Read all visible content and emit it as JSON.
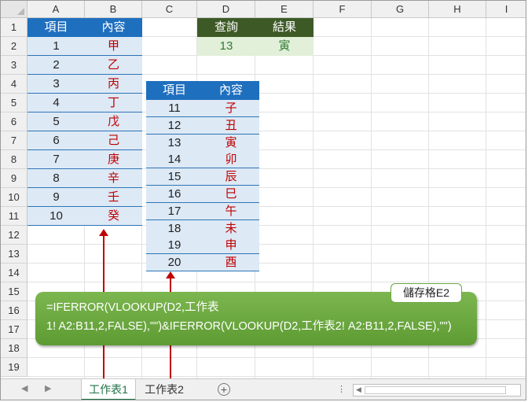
{
  "columns": [
    "A",
    "B",
    "C",
    "D",
    "E",
    "F",
    "G",
    "H",
    "I"
  ],
  "rows": [
    "1",
    "2",
    "3",
    "4",
    "5",
    "6",
    "7",
    "8",
    "9",
    "10",
    "11",
    "12",
    "13",
    "14",
    "15",
    "16",
    "17",
    "18",
    "19"
  ],
  "table1": {
    "headers": [
      "項目",
      "內容"
    ],
    "rows": [
      [
        "1",
        "甲"
      ],
      [
        "2",
        "乙"
      ],
      [
        "3",
        "丙"
      ],
      [
        "4",
        "丁"
      ],
      [
        "5",
        "戊"
      ],
      [
        "6",
        "己"
      ],
      [
        "7",
        "庚"
      ],
      [
        "8",
        "辛"
      ],
      [
        "9",
        "壬"
      ],
      [
        "10",
        "癸"
      ]
    ]
  },
  "table2": {
    "headers": [
      "項目",
      "內容"
    ],
    "rows": [
      [
        "11",
        "子"
      ],
      [
        "12",
        "丑"
      ],
      [
        "13",
        "寅"
      ],
      [
        "14",
        "卯"
      ],
      [
        "15",
        "辰"
      ],
      [
        "16",
        "巳"
      ],
      [
        "17",
        "午"
      ],
      [
        "18",
        "未"
      ],
      [
        "19",
        "申"
      ],
      [
        "20",
        "酉"
      ]
    ]
  },
  "lookup": {
    "headers": [
      "查詢",
      "結果"
    ],
    "query": "13",
    "result": "寅"
  },
  "callout": {
    "tag": "儲存格E2",
    "line1": "=IFERROR(VLOOKUP(D2,工作表",
    "line2": "1! A2:B11,2,FALSE),\"\")&IFERROR(VLOOKUP(D2,工作表2! A2:B11,2,FALSE),\"\")"
  },
  "sheet_tabs": [
    "工作表1",
    "工作表2"
  ],
  "active_tab": "工作表1",
  "colors": {
    "header_blue": "#1f6fbf",
    "header_green": "#3d5a26",
    "callout_green": "#6aa83f",
    "arrow_red": "#c00000",
    "text_red": "#c00000"
  }
}
